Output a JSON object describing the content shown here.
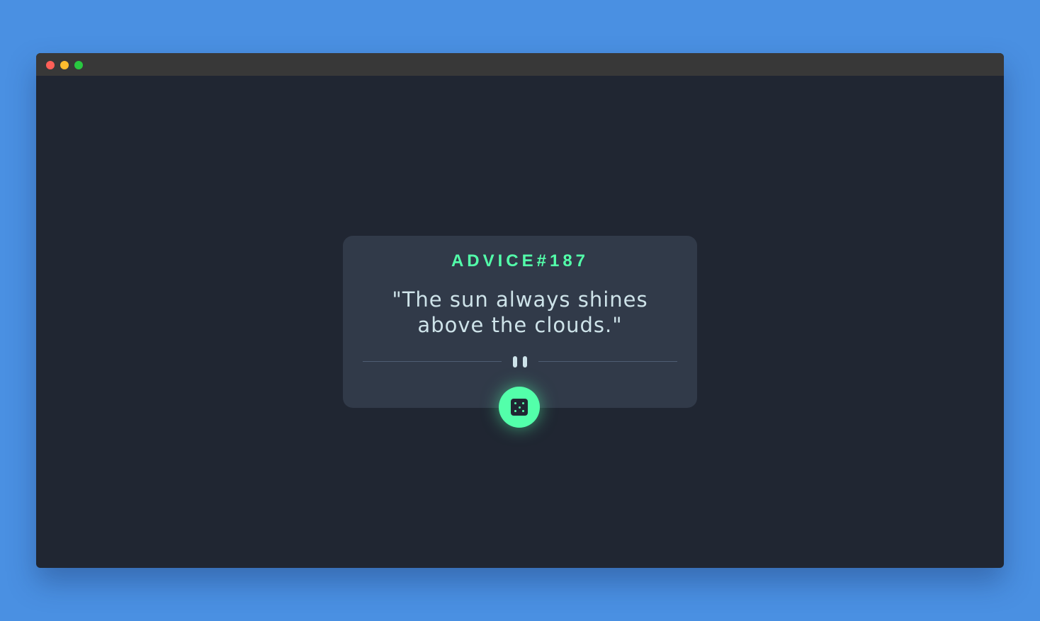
{
  "window": {
    "traffic_lights": [
      "close",
      "minimize",
      "maximize"
    ]
  },
  "card": {
    "advice_id": "ADVICE#187",
    "advice_text": "\"The sun always shines above the clouds.\"",
    "divider_icon": "pause-icon"
  },
  "button": {
    "icon": "dice-icon",
    "accent_color": "#53ffaa"
  },
  "colors": {
    "background": "#4a90e2",
    "window": "#202632",
    "card": "#313a49",
    "accent": "#53ffaa",
    "text": "#cee3e9"
  }
}
